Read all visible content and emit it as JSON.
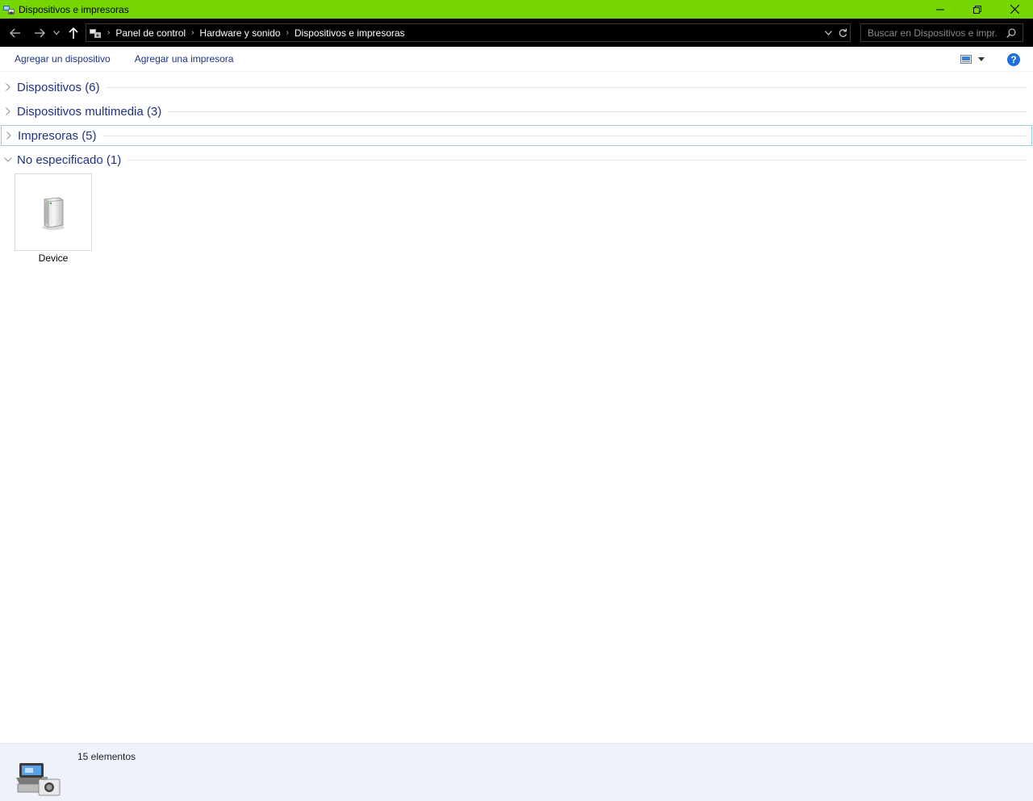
{
  "window": {
    "title": "Dispositivos e impresoras"
  },
  "address": {
    "breadcrumbs": [
      "Panel de control",
      "Hardware y sonido",
      "Dispositivos e impresoras"
    ]
  },
  "search": {
    "placeholder": "Buscar en Dispositivos e impr..."
  },
  "commands": {
    "add_device": "Agregar un dispositivo",
    "add_printer": "Agregar una impresora"
  },
  "groups": [
    {
      "label": "Dispositivos (6)",
      "expanded": false
    },
    {
      "label": "Dispositivos multimedia (3)",
      "expanded": false
    },
    {
      "label": "Impresoras (5)",
      "expanded": false,
      "focused": true
    },
    {
      "label": "No especificado (1)",
      "expanded": true
    }
  ],
  "items": [
    {
      "label": "Device",
      "icon": "generic-device-icon"
    }
  ],
  "status": {
    "count": "15 elementos"
  },
  "colors": {
    "titlebar": "#76d600",
    "link": "#1e3287",
    "details_bg": "#eef2fb"
  }
}
